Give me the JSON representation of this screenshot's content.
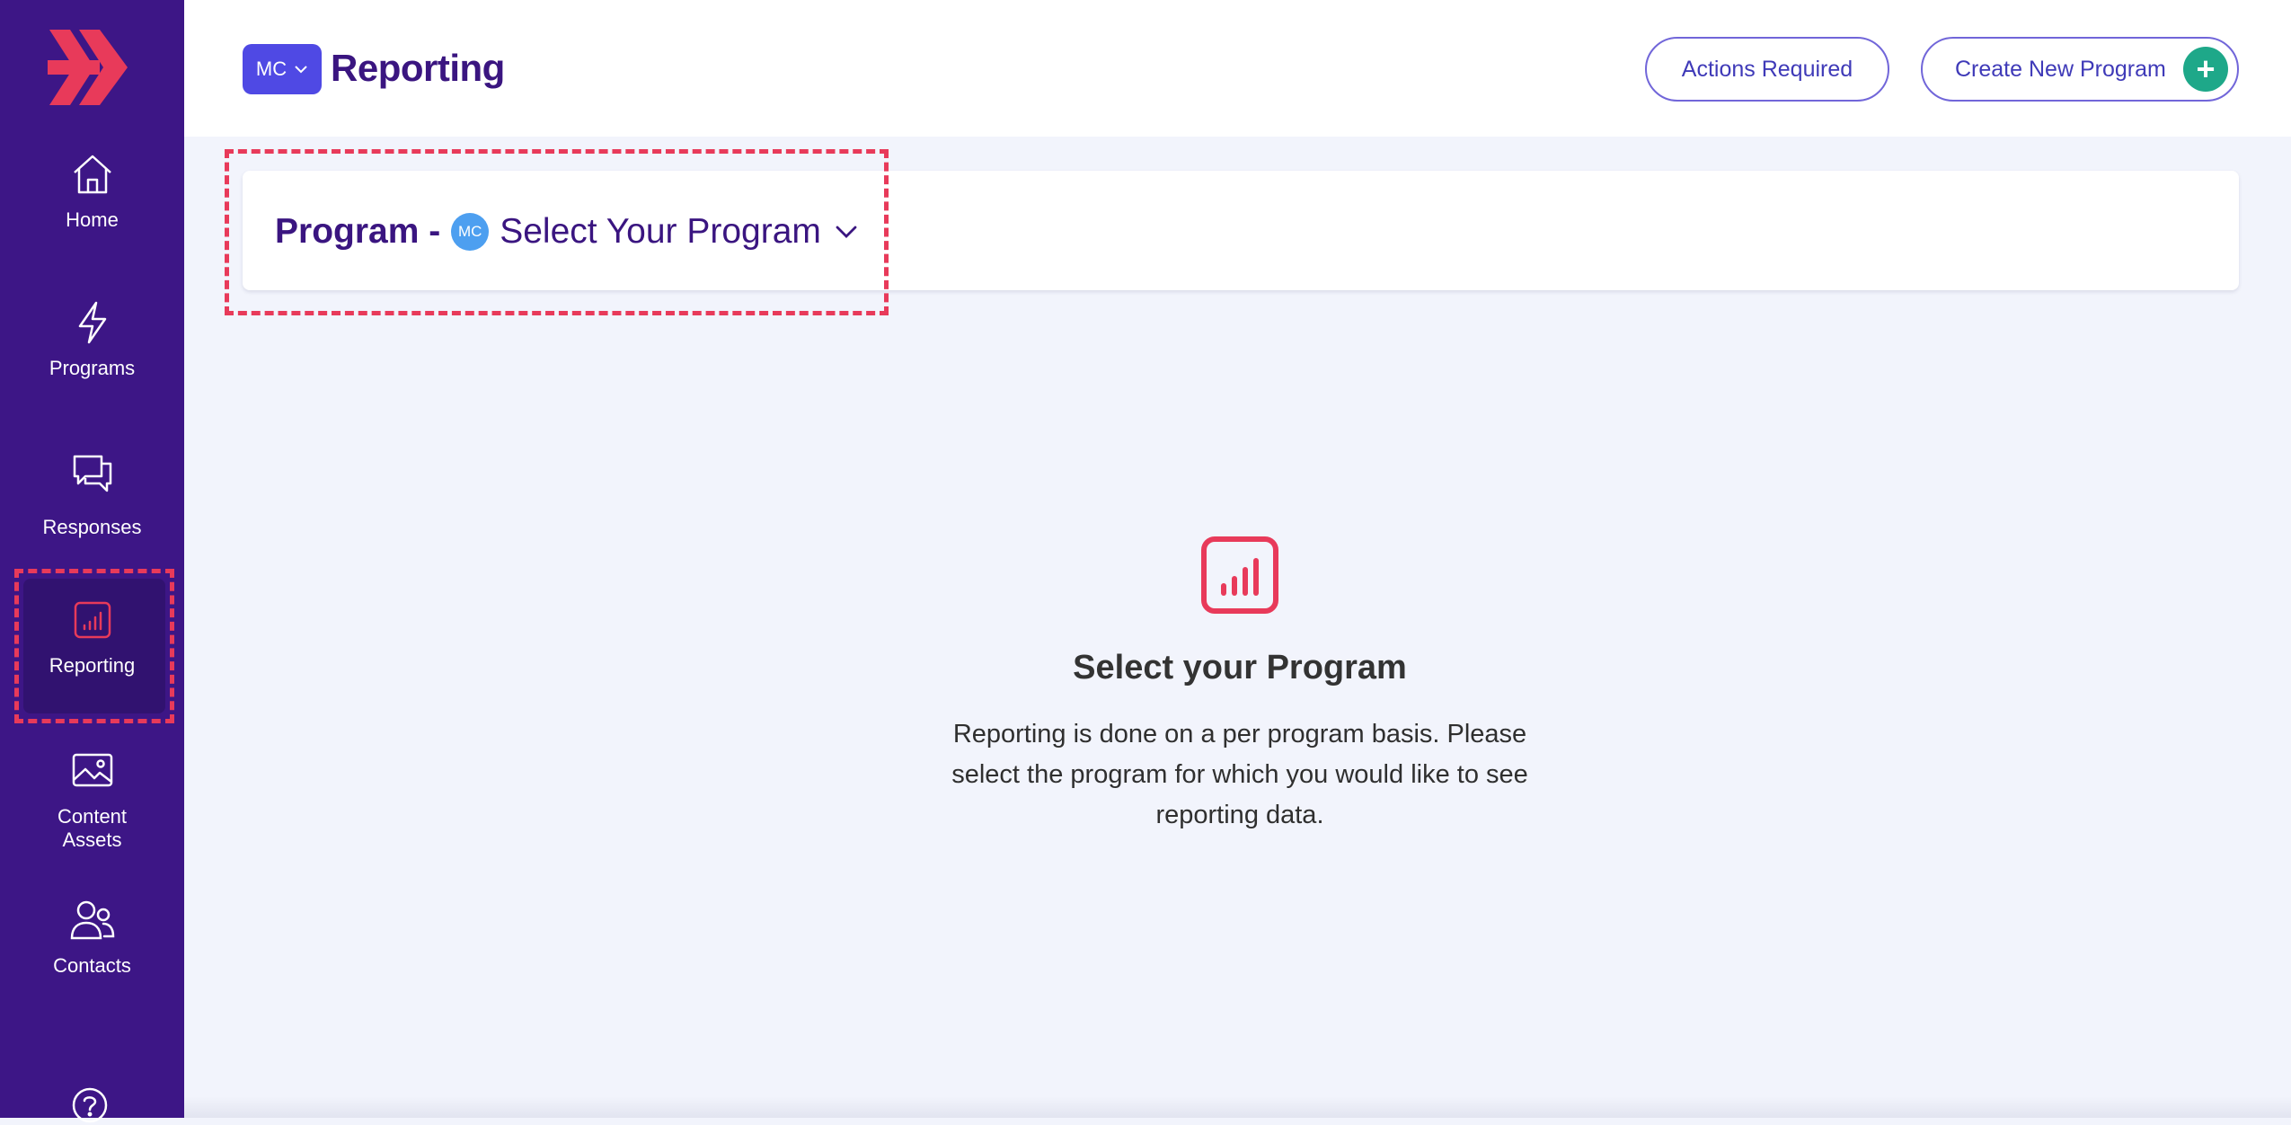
{
  "sidebar": {
    "items": [
      {
        "label": "Home",
        "icon": "home-icon"
      },
      {
        "label": "Programs",
        "icon": "lightning-icon"
      },
      {
        "label": "Responses",
        "icon": "chat-bubbles-icon"
      },
      {
        "label": "Reporting",
        "icon": "bar-chart-icon"
      },
      {
        "label": "Content Assets",
        "icon": "image-icon"
      },
      {
        "label": "Contacts",
        "icon": "users-icon"
      }
    ],
    "active_item": "Reporting",
    "bg_color": "#3d1686",
    "accent_color": "#e83a5a"
  },
  "header": {
    "workspace": "MC",
    "title": "Reporting",
    "actions_required_label": "Actions Required",
    "create_program_label": "Create New Program"
  },
  "program_selector": {
    "prefix": "Program -",
    "badge": "MC",
    "placeholder": "Select Your Program"
  },
  "empty_state": {
    "title": "Select your Program",
    "description": "Reporting is done on a per program basis. Please select the program for which you would like to see reporting data."
  }
}
